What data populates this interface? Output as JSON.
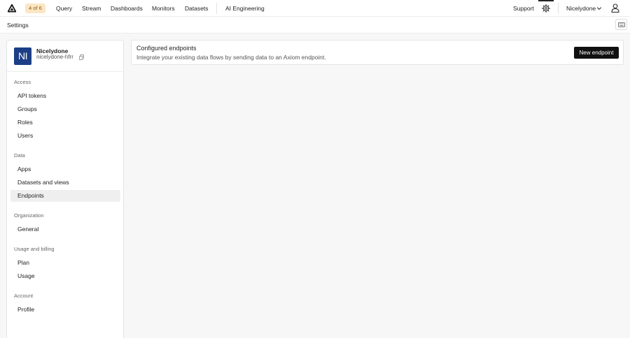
{
  "topbar": {
    "badge": "4 of 6",
    "nav": [
      {
        "label": "Query"
      },
      {
        "label": "Stream"
      },
      {
        "label": "Dashboards"
      },
      {
        "label": "Monitors"
      },
      {
        "label": "Datasets"
      },
      {
        "label": "AI Engineering"
      }
    ],
    "support": "Support",
    "org": "Nicelydone",
    "icons": [
      "axiom-logo-icon",
      "gear-icon",
      "chevron-down-icon",
      "user-icon"
    ]
  },
  "subbar": {
    "title": "Settings",
    "icons": [
      "keyboard-icon"
    ]
  },
  "sidebar": {
    "profile": {
      "initials": "NI",
      "name": "Nicelydone",
      "slug": "nicelydone-hfrr",
      "avatar_color": "#1c3e86"
    },
    "sections": [
      {
        "label": "Access",
        "items": [
          {
            "label": "API tokens"
          },
          {
            "label": "Groups"
          },
          {
            "label": "Roles"
          },
          {
            "label": "Users"
          }
        ]
      },
      {
        "label": "Data",
        "items": [
          {
            "label": "Apps"
          },
          {
            "label": "Datasets and views"
          },
          {
            "label": "Endpoints"
          }
        ]
      },
      {
        "label": "Organization",
        "items": [
          {
            "label": "General"
          }
        ]
      },
      {
        "label": "Usage and billing",
        "items": [
          {
            "label": "Plan"
          },
          {
            "label": "Usage"
          }
        ]
      },
      {
        "label": "Account",
        "items": [
          {
            "label": "Profile"
          }
        ]
      }
    ],
    "active_item": "Endpoints"
  },
  "main": {
    "title": "Configured endpoints",
    "subtitle": "Integrate your existing data flows by sending data to an Axiom endpoint.",
    "new_button": "New endpoint"
  }
}
